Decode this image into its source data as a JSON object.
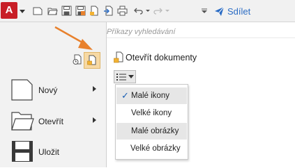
{
  "app": {
    "logo_letter": "A",
    "icon": "access-app-icon"
  },
  "toolbar": {
    "icons": [
      "new-file-icon",
      "open-folder-icon",
      "save-icon",
      "save-as-icon",
      "new-document-icon",
      "import-icon",
      "print-icon",
      "undo-icon",
      "redo-icon",
      "customize-toolbar-icon"
    ],
    "share_label": "Sdílet",
    "share_icon": "paper-plane-icon"
  },
  "search": {
    "placeholder": "Příkazy vyhledávání"
  },
  "left_panel": {
    "items": [
      {
        "label": "Nový",
        "icon": "new-document-icon",
        "has_submenu": true
      },
      {
        "label": "Otevřít",
        "icon": "open-folder-icon",
        "has_submenu": true
      },
      {
        "label": "Uložit",
        "icon": "save-icon",
        "has_submenu": false
      }
    ]
  },
  "open_documents": {
    "title": "Otevřít dokumenty",
    "view_button_icon": "list-view-icon",
    "menu": [
      {
        "label": "Malé ikony",
        "checked": true,
        "highlighted": true
      },
      {
        "label": "Velké ikony",
        "checked": false,
        "highlighted": false
      },
      {
        "label": "Malé obrázky",
        "checked": false,
        "highlighted": true
      },
      {
        "label": "Velké obrázky",
        "checked": false,
        "highlighted": false
      }
    ]
  },
  "colors": {
    "accent": "#2b6cc4",
    "app_red": "#c81e26",
    "arrow_orange": "#e8812d",
    "folder_yellow": "#f2b233"
  }
}
